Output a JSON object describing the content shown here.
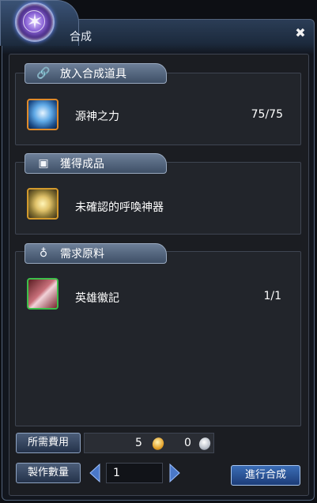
{
  "window": {
    "title": "合成"
  },
  "sections": {
    "input": {
      "header": "放入合成道具",
      "item_name": "源神之力",
      "item_count": "75/75"
    },
    "result": {
      "header": "獲得成品",
      "item_name": "未確認的呼喚神器"
    },
    "materials": {
      "header": "需求原料",
      "item_name": "英雄徽記",
      "item_count": "1/1"
    }
  },
  "cost": {
    "label": "所需費用",
    "gold_amount": "5",
    "silver_amount": "0"
  },
  "quantity": {
    "label": "製作數量",
    "value": "1"
  },
  "actions": {
    "craft_label": "進行合成"
  },
  "icons": {
    "emblem": "magic-circle-emblem-icon",
    "close": "close-icon",
    "input_header": "link-icon",
    "result_header": "box-icon",
    "materials_header": "pouch-icon",
    "gold_coin": "gold-coin-icon",
    "silver_coin": "silver-coin-icon",
    "decrease": "arrow-left-icon",
    "increase": "arrow-right-icon"
  }
}
